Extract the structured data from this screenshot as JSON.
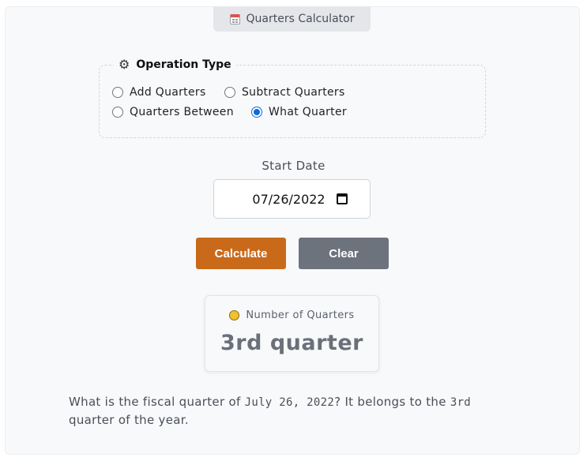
{
  "app": {
    "title": "Quarters Calculator"
  },
  "operation": {
    "legend": "Operation Type",
    "options": [
      {
        "label": "Add Quarters",
        "checked": false
      },
      {
        "label": "Subtract Quarters",
        "checked": false
      },
      {
        "label": "Quarters Between",
        "checked": false
      },
      {
        "label": "What Quarter",
        "checked": true
      }
    ]
  },
  "start_date": {
    "label": "Start Date",
    "value": "07/26/2022"
  },
  "buttons": {
    "calculate": "Calculate",
    "clear": "Clear"
  },
  "result": {
    "label": "Number of Quarters",
    "value": "3rd quarter"
  },
  "summary": {
    "prefix": "What is the fiscal quarter of ",
    "date": "July 26, 2022",
    "middle": "? It belongs to the ",
    "quarter": "3rd",
    "suffix": " quarter of the year."
  },
  "colors": {
    "accent": "#c96a1b",
    "secondary": "#6c737d",
    "radio_selected": "#0b6bd9"
  }
}
